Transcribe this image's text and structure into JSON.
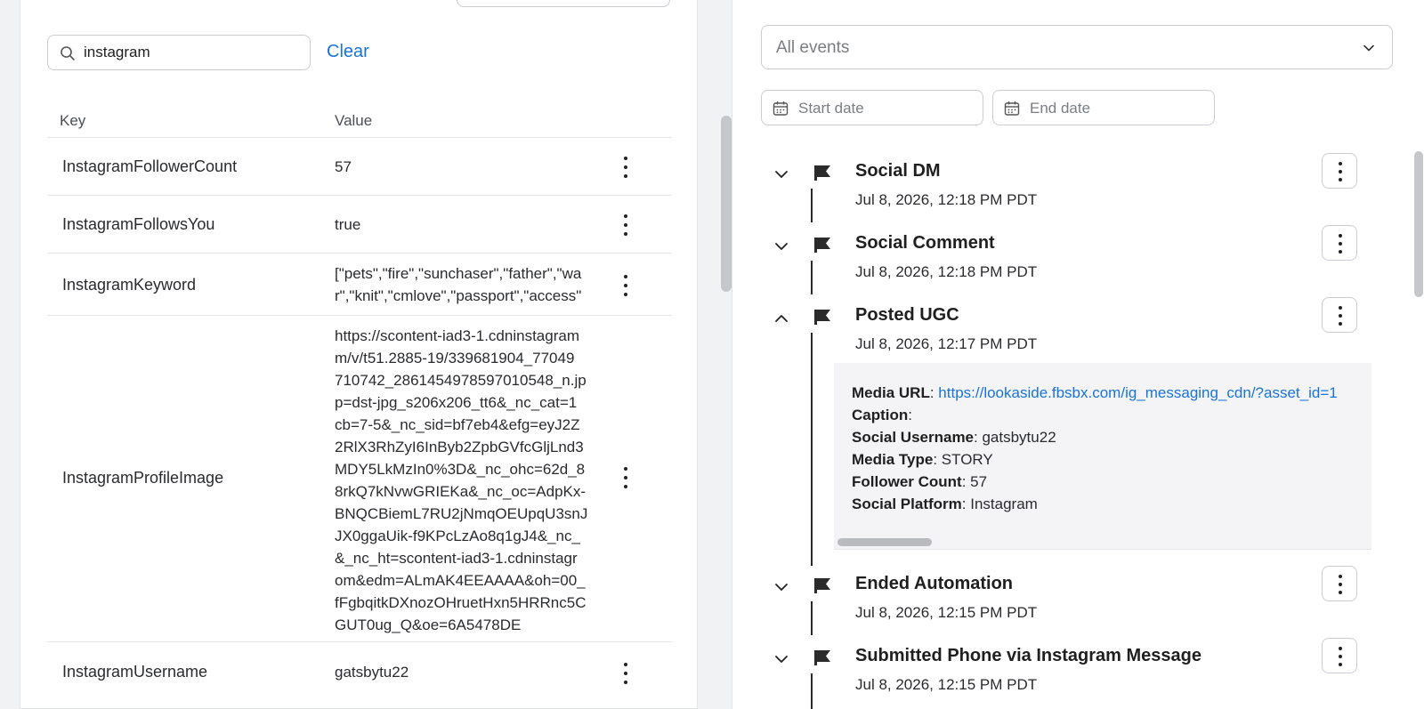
{
  "search": {
    "value": "instagram",
    "clear_label": "Clear"
  },
  "table": {
    "headers": {
      "key": "Key",
      "value": "Value"
    },
    "rows": [
      {
        "key": "InstagramFollowerCount",
        "value_lines": [
          "57"
        ]
      },
      {
        "key": "InstagramFollowsYou",
        "value_lines": [
          "true"
        ]
      },
      {
        "key": "InstagramKeyword",
        "value_lines": [
          "[\"pets\",\"fire\",\"sunchaser\",\"father\",\"wa",
          "r\",\"knit\",\"cmlove\",\"passport\",\"access\""
        ]
      },
      {
        "key": "InstagramProfileImage",
        "value_lines": [
          "https://scontent-iad3-1.cdninstagram",
          "m/v/t51.2885-19/339681904_77049",
          "710742_2861454978597010548_n.jp",
          "p=dst-jpg_s206x206_tt6&_nc_cat=1",
          "cb=7-5&_nc_sid=bf7eb4&efg=eyJ2Z",
          "2RlX3RhZyI6InByb2ZpbGVfcGljLnd3",
          "MDY5LkMzIn0%3D&_nc_ohc=62d_8",
          "8rkQ7kNvwGRIEKa&_nc_oc=AdpKx-",
          "BNQCBiemL7RU2jNmqOEUpqU3snJ",
          "JX0ggaUik-f9KPcLzAo8q1gJ4&_nc_",
          "&_nc_ht=scontent-iad3-1.cdninstagr",
          "om&edm=ALmAK4EEAAAA&oh=00_",
          "fFgbqitkDXnozOHruetHxn5HRRnc5C",
          "GUT0ug_Q&oe=6A5478DE"
        ]
      },
      {
        "key": "InstagramUsername",
        "value_lines": [
          "gatsbytu22"
        ]
      }
    ]
  },
  "filters": {
    "events_select": "All events",
    "start_date_placeholder": "Start date",
    "end_date_placeholder": "End date"
  },
  "events": [
    {
      "title": "Social DM",
      "time": "Jul 8, 2026, 12:18 PM PDT",
      "expanded": false
    },
    {
      "title": "Social Comment",
      "time": "Jul 8, 2026, 12:18 PM PDT",
      "expanded": false
    },
    {
      "title": "Posted UGC",
      "time": "Jul 8, 2026, 12:17 PM PDT",
      "expanded": true
    },
    {
      "title": "Ended Automation",
      "time": "Jul 8, 2026, 12:15 PM PDT",
      "expanded": false
    },
    {
      "title": "Submitted Phone via Instagram Message",
      "time": "Jul 8, 2026, 12:15 PM PDT",
      "expanded": false
    }
  ],
  "detail": {
    "media_url_label": "Media URL",
    "media_url": "https://lookaside.fbsbx.com/ig_messaging_cdn/?asset_id=1",
    "caption_label": "Caption",
    "caption": "",
    "username_label": "Social Username",
    "username": "gatsbytu22",
    "media_type_label": "Media Type",
    "media_type": "STORY",
    "follower_label": "Follower Count",
    "follower": "57",
    "platform_label": "Social Platform",
    "platform": "Instagram"
  }
}
